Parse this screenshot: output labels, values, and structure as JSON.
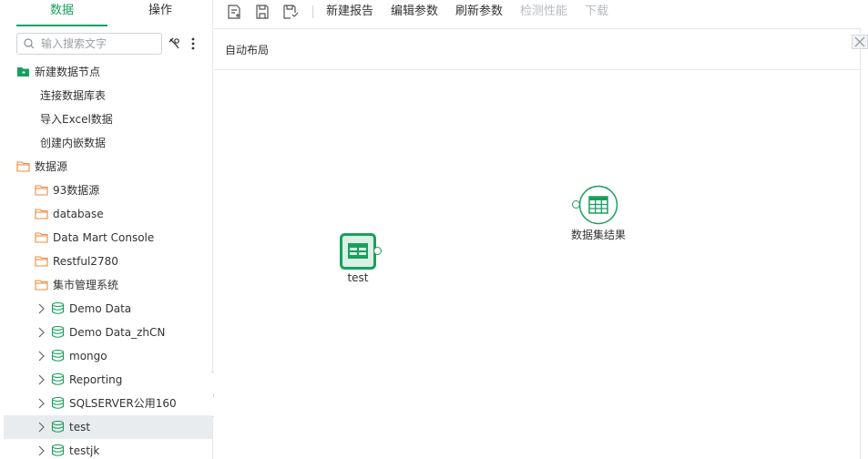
{
  "left_tabs": {
    "data": "数据",
    "ops": "操作"
  },
  "search": {
    "placeholder": "输入搜索文字"
  },
  "tree": {
    "new_node": "新建数据节点",
    "new_children": [
      "连接数据库表",
      "导入Excel数据",
      "创建内嵌数据"
    ],
    "datasource": "数据源",
    "folders": [
      "93数据源",
      "database",
      "Data Mart Console",
      "Restful2780",
      "集市管理系统"
    ],
    "databases": [
      "Demo Data",
      "Demo Data_zhCN",
      "mongo",
      "Reporting",
      "SQLSERVER公用160",
      "test",
      "testjk"
    ],
    "selected": "test"
  },
  "toolbar": {
    "new_report": "新建报告",
    "edit_params": "编辑参数",
    "refresh_params": "刷新参数",
    "check_perf": "检测性能",
    "download": "下载"
  },
  "canvas": {
    "auto_layout": "自动布局",
    "node_test": "test",
    "node_result": "数据集结果"
  },
  "colors": {
    "accent": "#17a05d",
    "folder": "#f08a3c",
    "selected_row": "#e9ecef"
  }
}
